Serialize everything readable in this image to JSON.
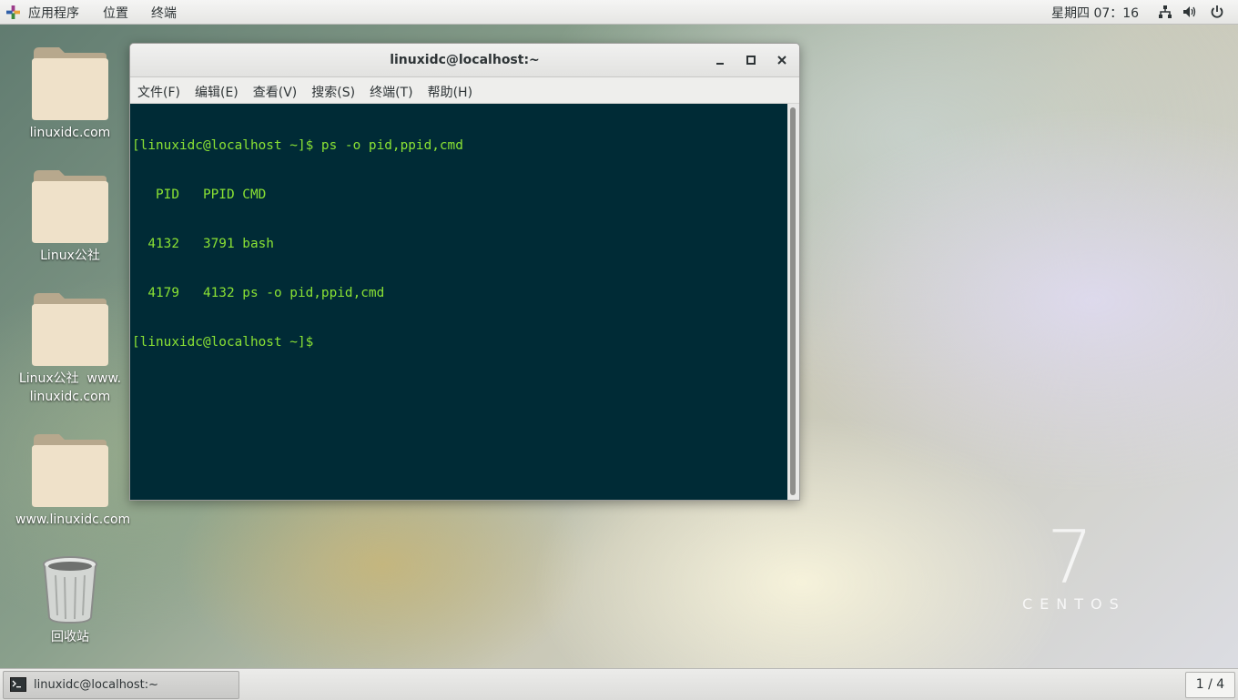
{
  "top_bar": {
    "applications": "应用程序",
    "places": "位置",
    "terminal": "终端",
    "clock": "星期四 07：16"
  },
  "desktop_icons": [
    {
      "label": "linuxidc.com",
      "type": "folder"
    },
    {
      "label": "Linux公社",
      "type": "folder"
    },
    {
      "label_line1": "Linux公社  www.",
      "label_line2": "linuxidc.com",
      "type": "folder"
    },
    {
      "label": "www.linuxidc.com",
      "type": "folder"
    },
    {
      "label": "回收站",
      "type": "trash"
    }
  ],
  "window": {
    "title": "linuxidc@localhost:~",
    "menu": [
      "文件(F)",
      "编辑(E)",
      "查看(V)",
      "搜索(S)",
      "终端(T)",
      "帮助(H)"
    ]
  },
  "terminal_lines": [
    "[linuxidc@localhost ~]$ ps -o pid,ppid,cmd",
    "   PID   PPID CMD",
    "  4132   3791 bash",
    "  4179   4132 ps -o pid,ppid,cmd",
    "[linuxidc@localhost ~]$ "
  ],
  "watermark": {
    "number": "7",
    "text": "CENTOS"
  },
  "bottom_bar": {
    "task_label": "linuxidc@localhost:~",
    "workspace": "1 / 4"
  },
  "colors": {
    "terminal_bg": "#002b36",
    "terminal_fg": "#8ae234"
  }
}
